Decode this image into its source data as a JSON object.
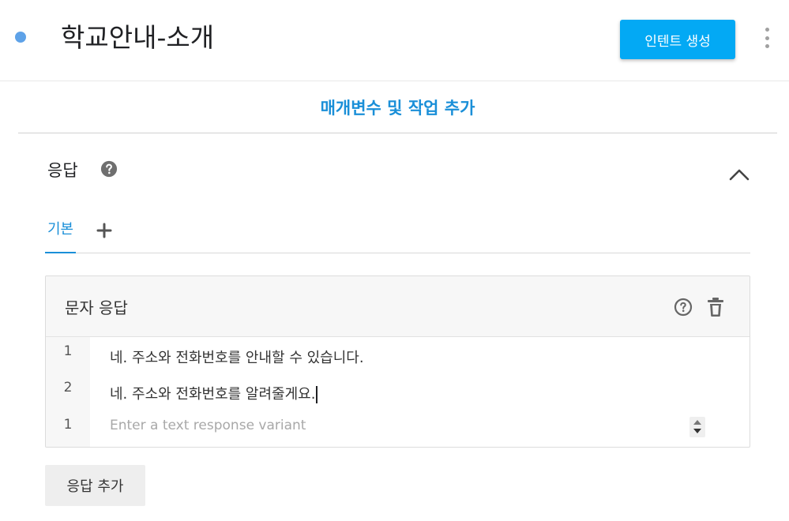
{
  "header": {
    "title": "학교안내-소개",
    "create_button": "인텐트 생성",
    "status_color": "#5ea2e8",
    "accent_color": "#03a9f4"
  },
  "add_params": {
    "label": "매개변수 및 작업 추가"
  },
  "responses": {
    "title": "응답",
    "help_icon": "help-circle-icon",
    "collapse_icon": "chevron-up-icon",
    "tabs": [
      {
        "label": "기본",
        "active": true
      }
    ],
    "add_tab_icon": "plus-icon"
  },
  "text_response": {
    "title": "문자 응답",
    "rows": [
      {
        "num": "1",
        "text": "네. 주소와 전화번호를 안내할 수 있습니다."
      },
      {
        "num": "2",
        "text": "네. 주소와 전화번호를 알려줄게요."
      }
    ],
    "new_row": {
      "num": "1",
      "placeholder": "Enter a text response variant"
    }
  },
  "add_response_button": "응답 추가"
}
